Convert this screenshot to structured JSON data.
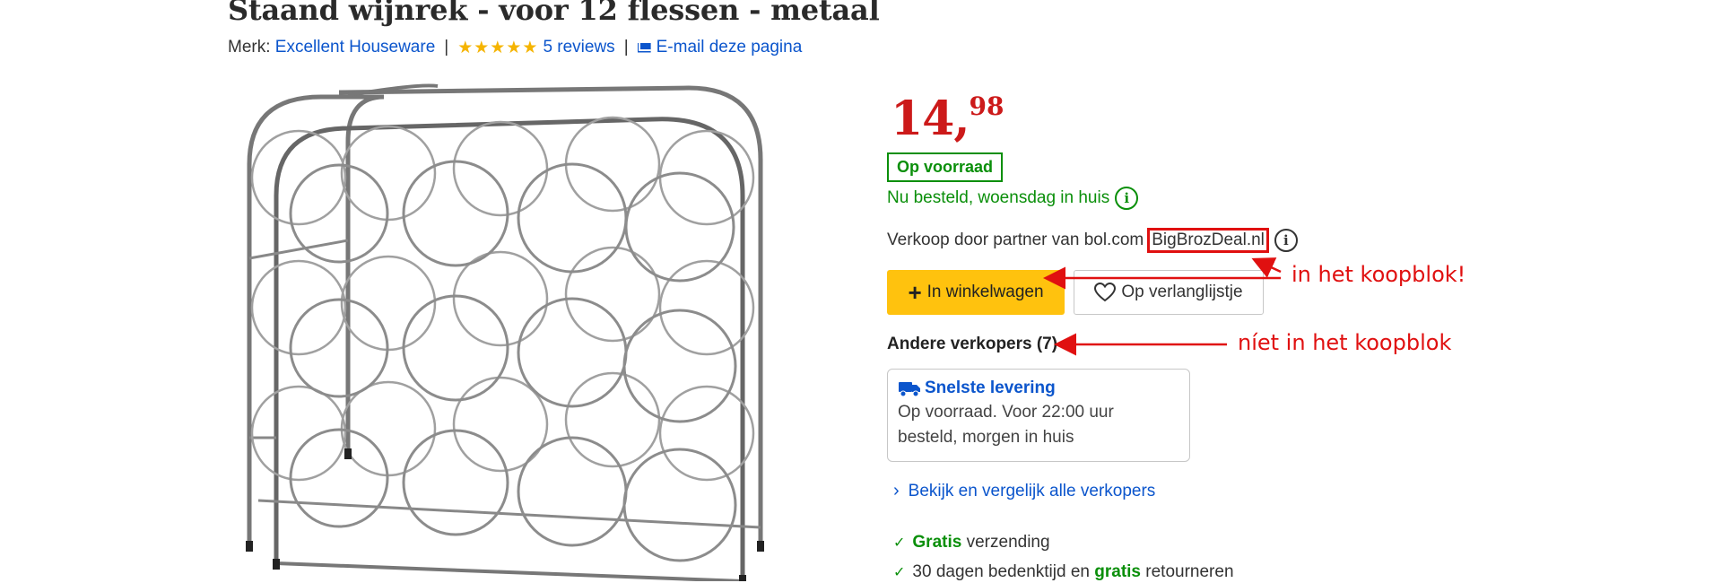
{
  "product": {
    "title": "Staand wijnrek - voor 12 flessen - metaal",
    "brand_label": "Merk:",
    "brand_name": "Excellent Houseware",
    "reviews": "5 reviews",
    "rating_stars": 5,
    "email_link": "E-mail deze pagina"
  },
  "price": {
    "euros": "14,",
    "cents": "98"
  },
  "stock": {
    "badge": "Op voorraad",
    "delivery": "Nu besteld, woensdag in huis",
    "info_icon": "i"
  },
  "seller": {
    "label": "Verkoop door partner van bol.com",
    "name": "BigBrozDeal.nl",
    "info_icon": "i"
  },
  "buttons": {
    "cart": "In winkelwagen",
    "cart_icon": "+",
    "wishlist": "Op verlanglijstje"
  },
  "other_sellers": "Andere verkopers (7)",
  "fast_delivery": {
    "title": "Snelste levering",
    "line1": "Op voorraad. Voor 22:00 uur",
    "line2": "besteld, morgen in huis"
  },
  "compare_link": "Bekijk en vergelijk alle verkopers",
  "usps": [
    {
      "bold": "Gratis",
      "rest": " verzending"
    },
    {
      "pre": "30 dagen bedenktijd en ",
      "bold": "gratis",
      "rest": " retourneren"
    }
  ],
  "annotations": {
    "in_buybox": "in het koopblok!",
    "not_in_buybox": "níet in het koopblok"
  },
  "colors": {
    "price": "#cc1a1a",
    "green": "#0a8f0a",
    "link": "#0b55cc",
    "cart": "#ffc20e",
    "annotation": "#e01010"
  }
}
